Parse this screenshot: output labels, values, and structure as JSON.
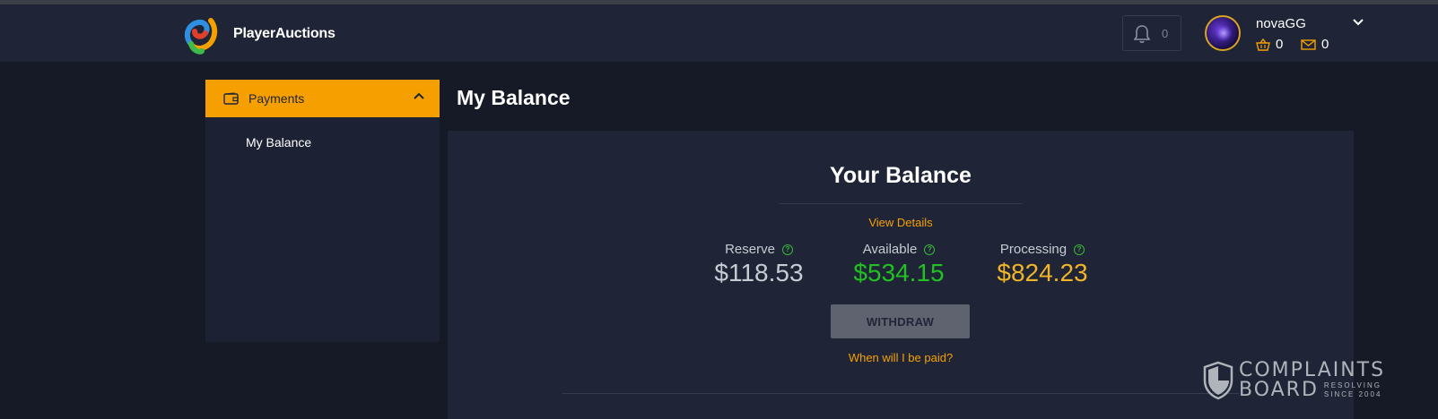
{
  "header": {
    "brand": "PlayerAuctions",
    "notifications_count": "0",
    "user": {
      "name": "novaGG",
      "cart_count": "0",
      "messages_count": "0"
    }
  },
  "sidebar": {
    "section_label": "Payments",
    "items": [
      {
        "label": "My Balance"
      }
    ]
  },
  "main": {
    "page_title": "My Balance",
    "card": {
      "title": "Your Balance",
      "view_details": "View Details",
      "stats": {
        "reserve": {
          "label": "Reserve",
          "amount": "$118.53",
          "help": "?"
        },
        "available": {
          "label": "Available",
          "amount": "$534.15",
          "help": "?"
        },
        "processing": {
          "label": "Processing",
          "amount": "$824.23",
          "help": "?"
        }
      },
      "withdraw_label": "WITHDRAW",
      "when_paid": "When will I be paid?"
    }
  },
  "watermark": {
    "line1": "COMPLAINTS",
    "line2": "BOARD",
    "tag1": "RESOLVING",
    "tag2": "SINCE 2004"
  },
  "colors": {
    "accent": "#f5a000",
    "available": "#22c022",
    "processing": "#f0b429",
    "background": "#151a26",
    "panel": "#1f2536"
  },
  "icons": [
    "bell-icon",
    "chevron-down-icon",
    "basket-icon",
    "mail-icon",
    "wallet-icon",
    "chevron-up-icon",
    "help-icon",
    "shield-icon"
  ]
}
